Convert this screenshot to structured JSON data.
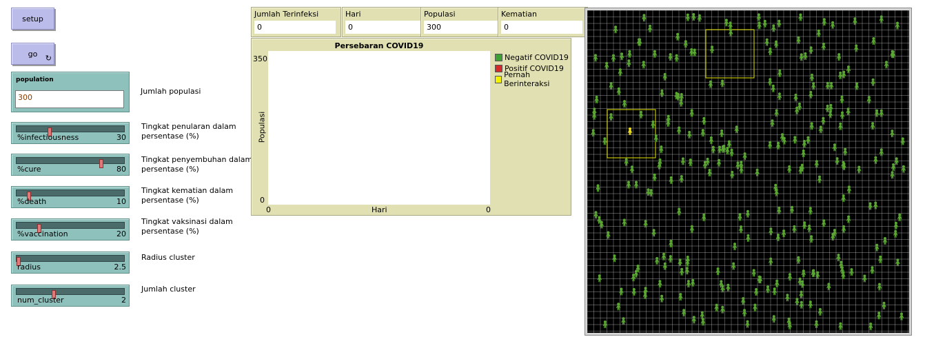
{
  "buttons": {
    "setup": "setup",
    "go": "go",
    "go_icon": "forever-icon"
  },
  "population_input": {
    "label": "population",
    "value": "300",
    "note": "Jumlah populasi"
  },
  "sliders": [
    {
      "name": "%infectiousness",
      "value": "30",
      "fraction": 0.3,
      "note1": "Tingkat penularan dalam",
      "note2": "persentase (%)"
    },
    {
      "name": "%cure",
      "value": "80",
      "fraction": 0.8,
      "note1": "Tingkat penyembuhan dalam",
      "note2": "persentase (%)"
    },
    {
      "name": "%death",
      "value": "10",
      "fraction": 0.1,
      "note1": "Tingkat kematian dalam",
      "note2": "persentase (%)"
    },
    {
      "name": "%vaccination",
      "value": "20",
      "fraction": 0.2,
      "note1": "Tingkat vaksinasi dalam",
      "note2": "persentase (%)"
    },
    {
      "name": "radius",
      "value": "2.5",
      "fraction": 0.0,
      "note1": "Radius cluster",
      "note2": ""
    },
    {
      "name": "num_cluster",
      "value": "2",
      "fraction": 0.34,
      "note1": "Jumlah cluster",
      "note2": ""
    }
  ],
  "monitors": [
    {
      "label": "Jumlah Terinfeksi",
      "value": "0"
    },
    {
      "label": "Hari",
      "value": "0"
    },
    {
      "label": "Populasi",
      "value": "300"
    },
    {
      "label": "Kematian",
      "value": "0"
    }
  ],
  "plot": {
    "title": "Persebaran COVID19",
    "xlabel": "Hari",
    "ylabel": "Populasi",
    "ymax": "350",
    "ymin": "0",
    "xmin": "0",
    "xmax": "0",
    "legend": [
      {
        "label": "Negatif COVID19",
        "color": "#3da133"
      },
      {
        "label": "Positif COVID19",
        "color": "#d42a2a"
      },
      {
        "label": "Pernah Berinteraksi",
        "color": "#f2f200"
      }
    ]
  },
  "colors": {
    "person_healthy": "#5aa832",
    "person_infected": "#f2e21e",
    "world_bg": "#000000",
    "grid": "#c8c8c8",
    "cluster_outline": "#e6e600"
  }
}
